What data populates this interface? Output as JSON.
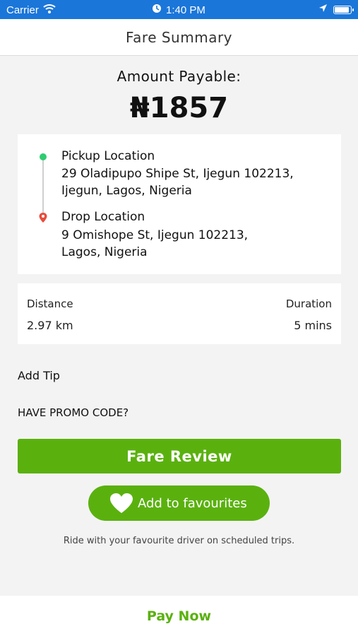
{
  "status_bar": {
    "carrier": "Carrier",
    "time": "1:40 PM",
    "icons": [
      "wifi-icon",
      "alarm-icon",
      "location-arrow-icon",
      "battery-icon"
    ],
    "battery_level": 0.9
  },
  "nav": {
    "title": "Fare Summary"
  },
  "amount": {
    "label": "Amount Payable:",
    "value": "₦1857"
  },
  "route": {
    "pickup_title": "Pickup Location",
    "pickup_address": "29 Oladipupo Shipe St, Ijegun 102213, Ijegun, Lagos, Nigeria",
    "drop_title": "Drop Location",
    "drop_address": "9 Omishope St, Ijegun 102213, Lagos, Nigeria"
  },
  "trip_info": {
    "distance_label": "Distance",
    "distance_value": "2.97 km",
    "duration_label": "Duration",
    "duration_value": "5 mins"
  },
  "add_tip": "Add Tip",
  "promo": "HAVE PROMO CODE?",
  "fare_review_button": "Fare Review",
  "favourites_button": "Add to favourites",
  "favourites_hint": "Ride with your favourite driver on scheduled trips.",
  "pay_now": "Pay Now",
  "colors": {
    "status_bar": "#1b76d9",
    "accent_green": "#5ab10e",
    "pickup_dot": "#2ecc71",
    "drop_pin": "#e74c3c"
  }
}
